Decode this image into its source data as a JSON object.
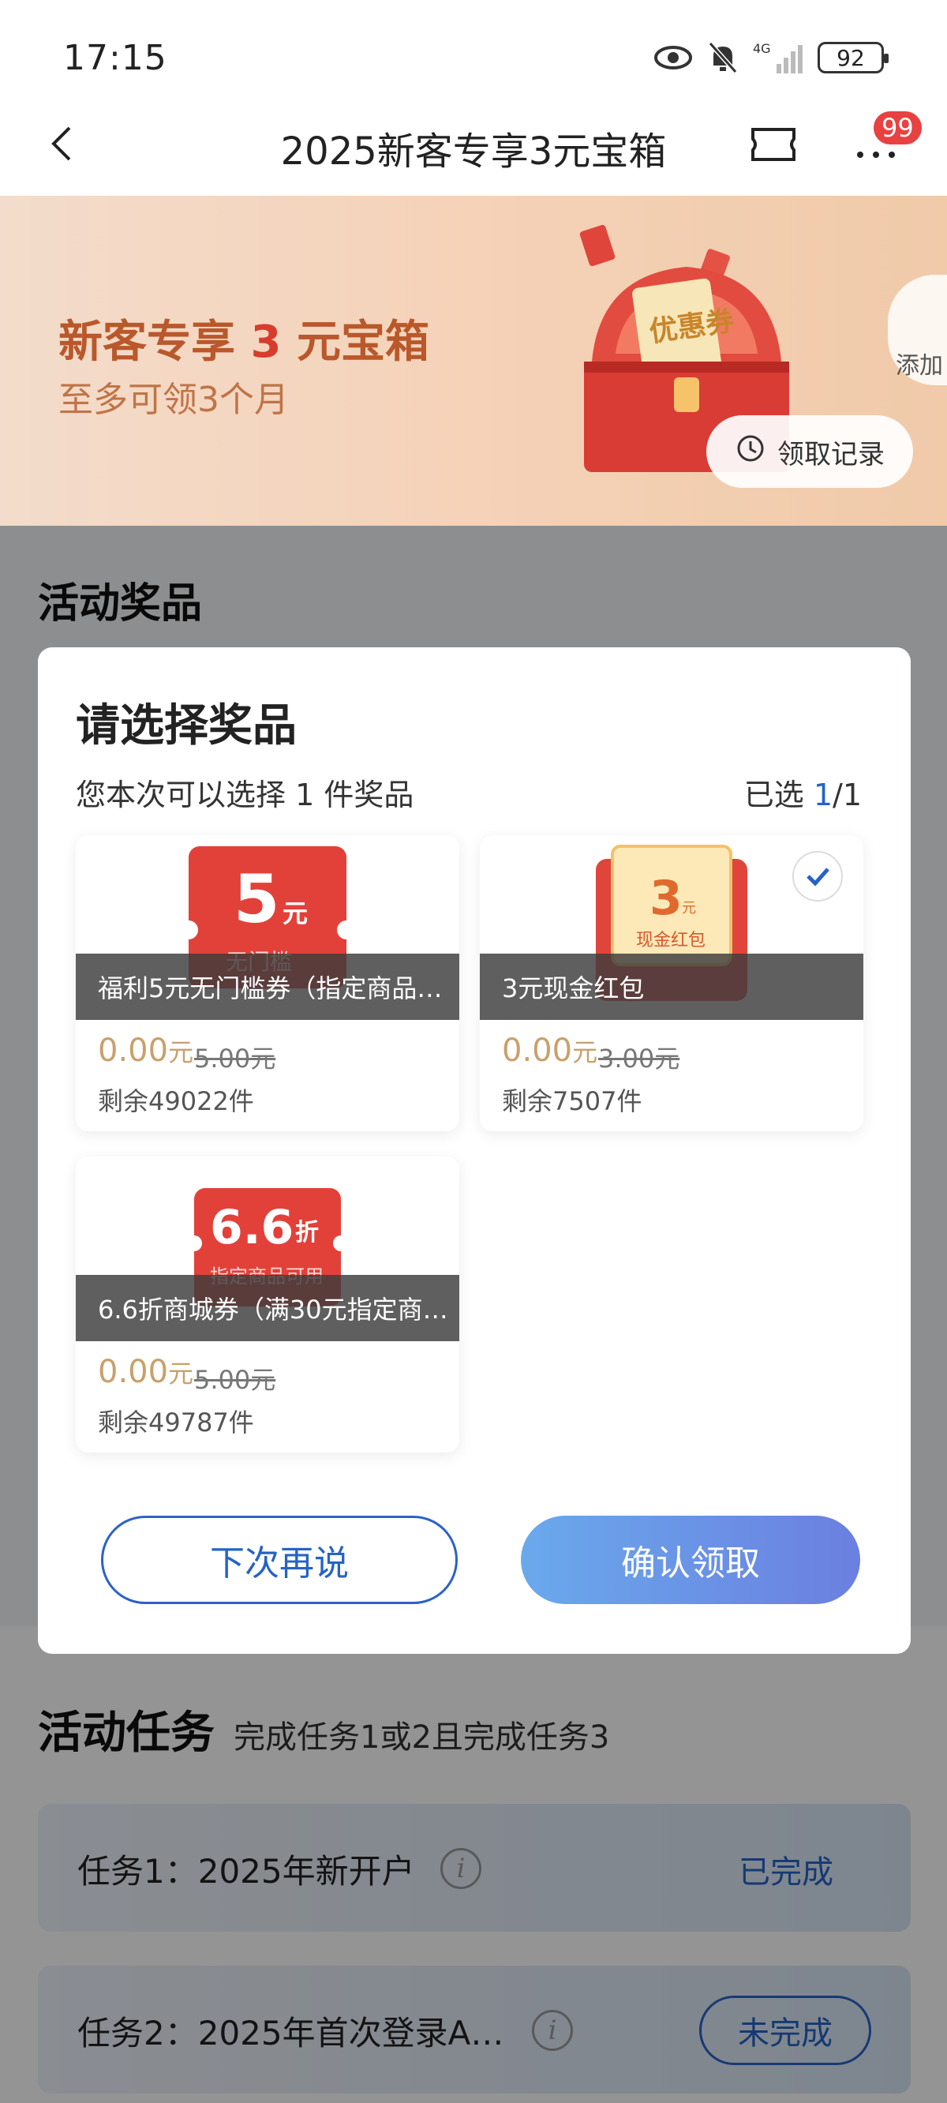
{
  "status_bar": {
    "time": "17:15",
    "battery": "92",
    "network": "4G"
  },
  "header": {
    "title": "2025新客专享3元宝箱",
    "badge_count": "99"
  },
  "banner": {
    "title_prefix": "新客专享",
    "title_accent": "3",
    "title_suffix": "元宝箱",
    "subtitle": "至多可领3个月",
    "add_label": "添加",
    "record_label": "领取记录",
    "chest_ticket_text": "优惠券"
  },
  "prize_section": {
    "title": "活动奖品"
  },
  "modal": {
    "title": "请选择奖品",
    "description": "您本次可以选择 1 件奖品",
    "selected_prefix": "已选 ",
    "selected_count": "1",
    "selected_total": "/1",
    "prizes": [
      {
        "name": "福利5元无门槛券（指定商品…",
        "image_big": "5",
        "image_unit": "元",
        "image_sub": "无门槛",
        "price_now": "0.00",
        "price_unit": "元",
        "price_original": "5.00元",
        "stock": "剩余49022件",
        "selected": false
      },
      {
        "name": "3元现金红包",
        "image_big": "3",
        "image_unit": "元",
        "image_sub": "现金红包",
        "price_now": "0.00",
        "price_unit": "元",
        "price_original": "3.00元",
        "stock": "剩余7507件",
        "selected": true
      },
      {
        "name": "6.6折商城券（满30元指定商…",
        "image_big": "6.6",
        "image_unit": "折",
        "image_sub": "指定商品可用",
        "price_now": "0.00",
        "price_unit": "元",
        "price_original": "5.00元",
        "stock": "剩余49787件",
        "selected": false
      }
    ],
    "later_label": "下次再说",
    "confirm_label": "确认领取"
  },
  "tasks": {
    "title": "活动任务",
    "subtitle": "完成任务1或2且完成任务3",
    "items": [
      {
        "label": "任务1：2025年新开户",
        "status": "已完成"
      },
      {
        "label": "任务2：2025年首次登录A…",
        "status": "未完成"
      }
    ]
  },
  "colors": {
    "accent_blue": "#2563c5",
    "banner_orange": "#b9582b",
    "red": "#d83c2d",
    "price_gold": "#c9a06b"
  }
}
